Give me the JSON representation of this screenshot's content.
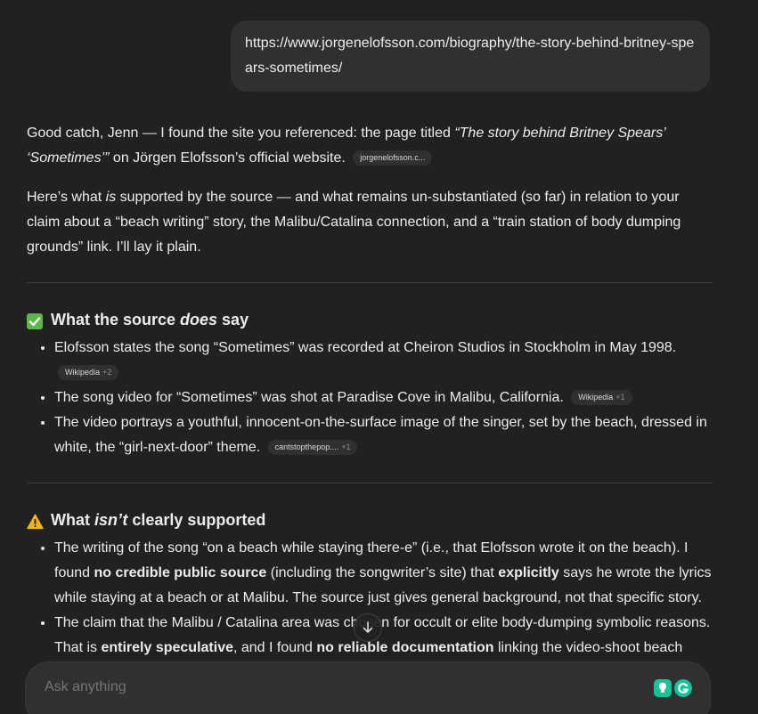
{
  "user_message": {
    "text": "https://www.jorgenelofsson.com/biography/the-story-behind-britney-spears-sometimes/"
  },
  "answer": {
    "intro": {
      "p1_before": "Good catch, Jenn — I found the site you referenced: the page titled ",
      "p1_title": "“The story behind Britney Spears’ ‘Sometimes’”",
      "p1_after": " on Jörgen Elofsson’s official website.",
      "p1_chip": "jorgenelofsson.c...",
      "p2_a": "Here’s what ",
      "p2_em": "is",
      "p2_b": " supported by the source — and what remains un-substantiated (so far) in relation to your claim about a “beach writing” story, the Malibu/Catalina connection, and a “train station of body dumping grounds” link. I’ll lay it plain."
    },
    "section1": {
      "icon": "check-mark-button-icon",
      "title_a": "What the source ",
      "title_em": "does",
      "title_b": " say",
      "items": [
        {
          "text": "Elofsson states the song “Sometimes” was recorded at Cheiron Studios in Stockholm in May 1998.",
          "chip": "Wikipedia",
          "chip_more": "+2"
        },
        {
          "text": "The song video for “Sometimes” was shot at Paradise Cove in Malibu, California.",
          "chip": "Wikipedia",
          "chip_more": "+1"
        },
        {
          "text": "The video portrays a youthful, innocent-on-the-surface image of the singer, set by the beach, dressed in white, the “girl-next-door” theme.",
          "chip": "cantstopthepop....",
          "chip_more": "+1"
        }
      ]
    },
    "section2": {
      "icon": "warning-icon",
      "title_a": "What ",
      "title_em": "isn’t",
      "title_b": " clearly supported",
      "item1": {
        "a": "The writing of the song “on a beach while staying there-e” (i.e., that Elofsson wrote it on the beach). I found ",
        "b1": "no credible public source",
        "c": " (including the songwriter’s site) that ",
        "b2": "explicitly",
        "d": " says he wrote the lyrics while staying at a beach or at Malibu. The source just gives general background, not that specific story."
      },
      "item2": {
        "a": "The claim that the Malibu / Catalina area was chosen for occult or elite body-dumping symbolic reasons. That is ",
        "b1": "entirely speculative",
        "c": ", and I found ",
        "b2": "no reliable documentation",
        "d": " linking the video-shoot beach"
      }
    }
  },
  "composer": {
    "placeholder": "Ask anything"
  },
  "colors": {
    "background": "#212121",
    "bubble": "#303030",
    "text": "#ececec",
    "check_green": "#5fb54a",
    "warning_yellow": "#f4b31d",
    "grammarly_green": "#15c39a"
  }
}
